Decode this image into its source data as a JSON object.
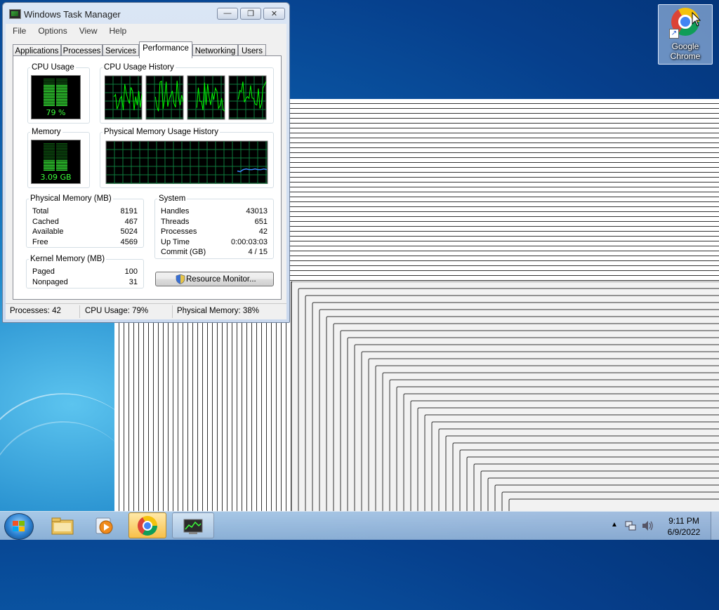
{
  "window": {
    "title": "Windows Task Manager",
    "minimize_glyph": "—",
    "maximize_glyph": "❐",
    "close_glyph": "✕",
    "menu": [
      "File",
      "Options",
      "View",
      "Help"
    ],
    "tabs": [
      "Applications",
      "Processes",
      "Services",
      "Performance",
      "Networking",
      "Users"
    ],
    "active_tab": "Performance"
  },
  "performance": {
    "cpu_usage_title": "CPU Usage",
    "cpu_usage_value": "79 %",
    "cpu_usage_fraction": 0.79,
    "cpu_history_title": "CPU Usage History",
    "memory_title": "Memory",
    "memory_value": "3.09 GB",
    "memory_fraction": 0.38,
    "mem_history_title": "Physical Memory Usage History",
    "physical_memory": {
      "title": "Physical Memory (MB)",
      "rows": [
        {
          "label": "Total",
          "value": "8191"
        },
        {
          "label": "Cached",
          "value": "467"
        },
        {
          "label": "Available",
          "value": "5024"
        },
        {
          "label": "Free",
          "value": "4569"
        }
      ]
    },
    "kernel_memory": {
      "title": "Kernel Memory (MB)",
      "rows": [
        {
          "label": "Paged",
          "value": "100"
        },
        {
          "label": "Nonpaged",
          "value": "31"
        }
      ]
    },
    "system": {
      "title": "System",
      "rows": [
        {
          "label": "Handles",
          "value": "43013"
        },
        {
          "label": "Threads",
          "value": "651"
        },
        {
          "label": "Processes",
          "value": "42"
        },
        {
          "label": "Up Time",
          "value": "0:00:03:03"
        },
        {
          "label": "Commit (GB)",
          "value": "4 / 15"
        }
      ]
    },
    "resource_monitor_button": "Resource Monitor..."
  },
  "status_bar": {
    "processes": "Processes: 42",
    "cpu": "CPU Usage: 79%",
    "memory": "Physical Memory: 38%"
  },
  "desktop": {
    "icon_label_line1": "Google",
    "icon_label_line2": "Chrome",
    "icon_name": "google-chrome-icon"
  },
  "taskbar": {
    "items": [
      {
        "name": "start-button",
        "icon": "windows-logo-icon"
      },
      {
        "name": "explorer",
        "icon": "folder-icon"
      },
      {
        "name": "media-player",
        "icon": "media-player-icon"
      },
      {
        "name": "chrome",
        "icon": "chrome-icon"
      },
      {
        "name": "task-manager",
        "icon": "task-manager-icon"
      }
    ],
    "time": "9:11 PM",
    "date": "6/9/2022"
  },
  "colors": {
    "meter_green": "#3bff3b",
    "graph_grid": "#0e7a3c",
    "graph_line": "#00ff00",
    "mem_line": "#3b8bff"
  }
}
